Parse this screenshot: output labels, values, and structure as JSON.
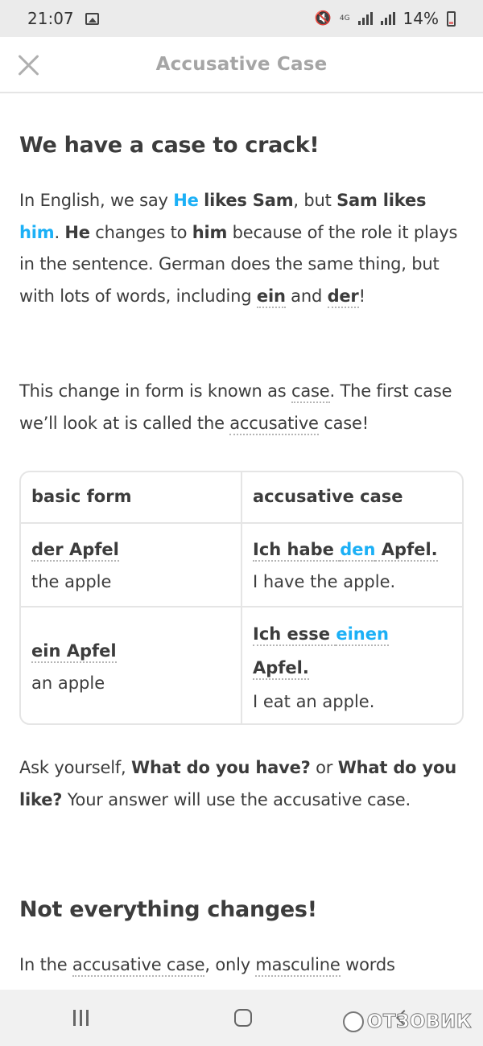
{
  "status_bar": {
    "time": "21:07",
    "network": "4G",
    "battery": "14%"
  },
  "header": {
    "title": "Accusative Case"
  },
  "section1": {
    "heading": "We have a case to crack!",
    "p1": [
      {
        "t": "In English, we say ",
        "s": "n"
      },
      {
        "t": "He",
        "s": "blue"
      },
      {
        "t": " ",
        "s": "n"
      },
      {
        "t": "likes Sam",
        "s": "b"
      },
      {
        "t": ", but ",
        "s": "n"
      },
      {
        "t": "Sam likes",
        "s": "b"
      },
      {
        "t": " ",
        "s": "n"
      },
      {
        "t": "him",
        "s": "blue"
      },
      {
        "t": ". ",
        "s": "n"
      },
      {
        "t": "He",
        "s": "b"
      },
      {
        "t": " changes to ",
        "s": "n"
      },
      {
        "t": "him",
        "s": "b"
      },
      {
        "t": " because of the role it plays in the sentence. German does the same thing, but with lots of words, including ",
        "s": "n"
      },
      {
        "t": "ein",
        "s": "bd"
      },
      {
        "t": " and ",
        "s": "n"
      },
      {
        "t": "der",
        "s": "bd"
      },
      {
        "t": "!",
        "s": "n"
      }
    ],
    "p2": [
      {
        "t": "This change in form is known as ",
        "s": "n"
      },
      {
        "t": "case",
        "s": "d"
      },
      {
        "t": ". The first case we’ll look at is called the ",
        "s": "n"
      },
      {
        "t": "accusative",
        "s": "d"
      },
      {
        "t": " case!",
        "s": "n"
      }
    ]
  },
  "table": {
    "headers": [
      "basic form",
      "accusative case"
    ],
    "rows": [
      {
        "basic_de": "der Apfel",
        "basic_en": "the apple",
        "acc_de": [
          {
            "t": "Ich habe ",
            "s": "bd"
          },
          {
            "t": "den",
            "s": "blued"
          },
          {
            "t": " Apfel.",
            "s": "bd"
          }
        ],
        "acc_en": "I have the apple."
      },
      {
        "basic_de": "ein Apfel",
        "basic_en": "an apple",
        "acc_de": [
          {
            "t": "Ich esse ",
            "s": "bd"
          },
          {
            "t": "einen",
            "s": "blued"
          }
        ],
        "acc_de_line2": "Apfel.",
        "acc_en": "I eat an apple."
      }
    ]
  },
  "section1_tail": [
    {
      "t": "Ask yourself, ",
      "s": "n"
    },
    {
      "t": "What do you have?",
      "s": "b"
    },
    {
      "t": " or ",
      "s": "n"
    },
    {
      "t": "What do you like?",
      "s": "b"
    },
    {
      "t": " Your answer will use the accusative case.",
      "s": "n"
    }
  ],
  "section2": {
    "heading": "Not everything changes!",
    "p1": [
      {
        "t": "In the ",
        "s": "n"
      },
      {
        "t": "accusative case",
        "s": "d"
      },
      {
        "t": ", only ",
        "s": "n"
      },
      {
        "t": "masculine",
        "s": "d"
      },
      {
        "t": " words",
        "s": "n"
      }
    ]
  },
  "watermark": "ОТЗОВИК"
}
